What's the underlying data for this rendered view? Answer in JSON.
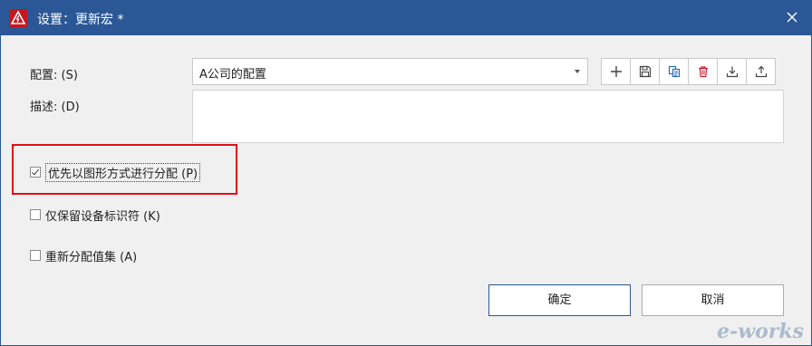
{
  "window": {
    "title": "设置：更新宏 *",
    "accent_color": "#2b5797",
    "app_icon": "warning-triangle-icon",
    "close_icon": "close-icon"
  },
  "config": {
    "label": "配置: (S)",
    "selected": "A公司的配置",
    "toolbar_icons": [
      "plus-icon",
      "save-icon",
      "copy-icon",
      "delete-icon",
      "import-icon",
      "export-icon"
    ]
  },
  "description": {
    "label": "描述: (D)",
    "value": ""
  },
  "options": [
    {
      "label": "优先以图形方式进行分配 (P)",
      "checked": true
    },
    {
      "label": "仅保留设备标识符 (K)",
      "checked": false
    },
    {
      "label": "重新分配值集 (A)",
      "checked": false
    }
  ],
  "buttons": {
    "ok": "确定",
    "cancel": "取消"
  },
  "watermark": "e-works"
}
